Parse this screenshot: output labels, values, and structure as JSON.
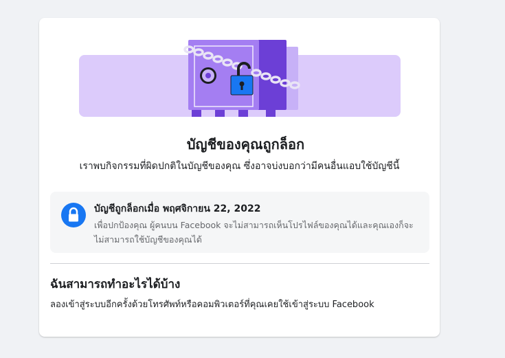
{
  "card": {
    "title": "บัญชีของคุณถูกล็อก",
    "subtitle": "เราพบกิจกรรมที่ผิดปกติในบัญชีของคุณ ซึ่งอาจบ่งบอกว่ามีคนอื่นแอบใช้บัญชีนี้"
  },
  "info": {
    "icon": "lock-icon",
    "title": "บัญชีถูกล็อกเมื่อ พฤศจิกายน 22, 2022",
    "description": "เพื่อปกป้องคุณ ผู้คนบน Facebook จะไม่สามารถเห็นโปรไฟล์ของคุณได้และคุณเองก็จะไม่สามารถใช้บัญชีของคุณได้"
  },
  "help": {
    "title": "ฉันสามารถทำอะไรได้บ้าง",
    "description": "ลองเข้าสู่ระบบอีกครั้งด้วยโทรศัพท์หรือคอมพิวเตอร์ที่คุณเคยใช้เข้าสู่ระบบ Facebook"
  },
  "colors": {
    "accent": "#1877f2",
    "illustration_bg": "#dccbfb",
    "safe_body": "#a47ef2",
    "safe_dark": "#6c3fd6"
  }
}
